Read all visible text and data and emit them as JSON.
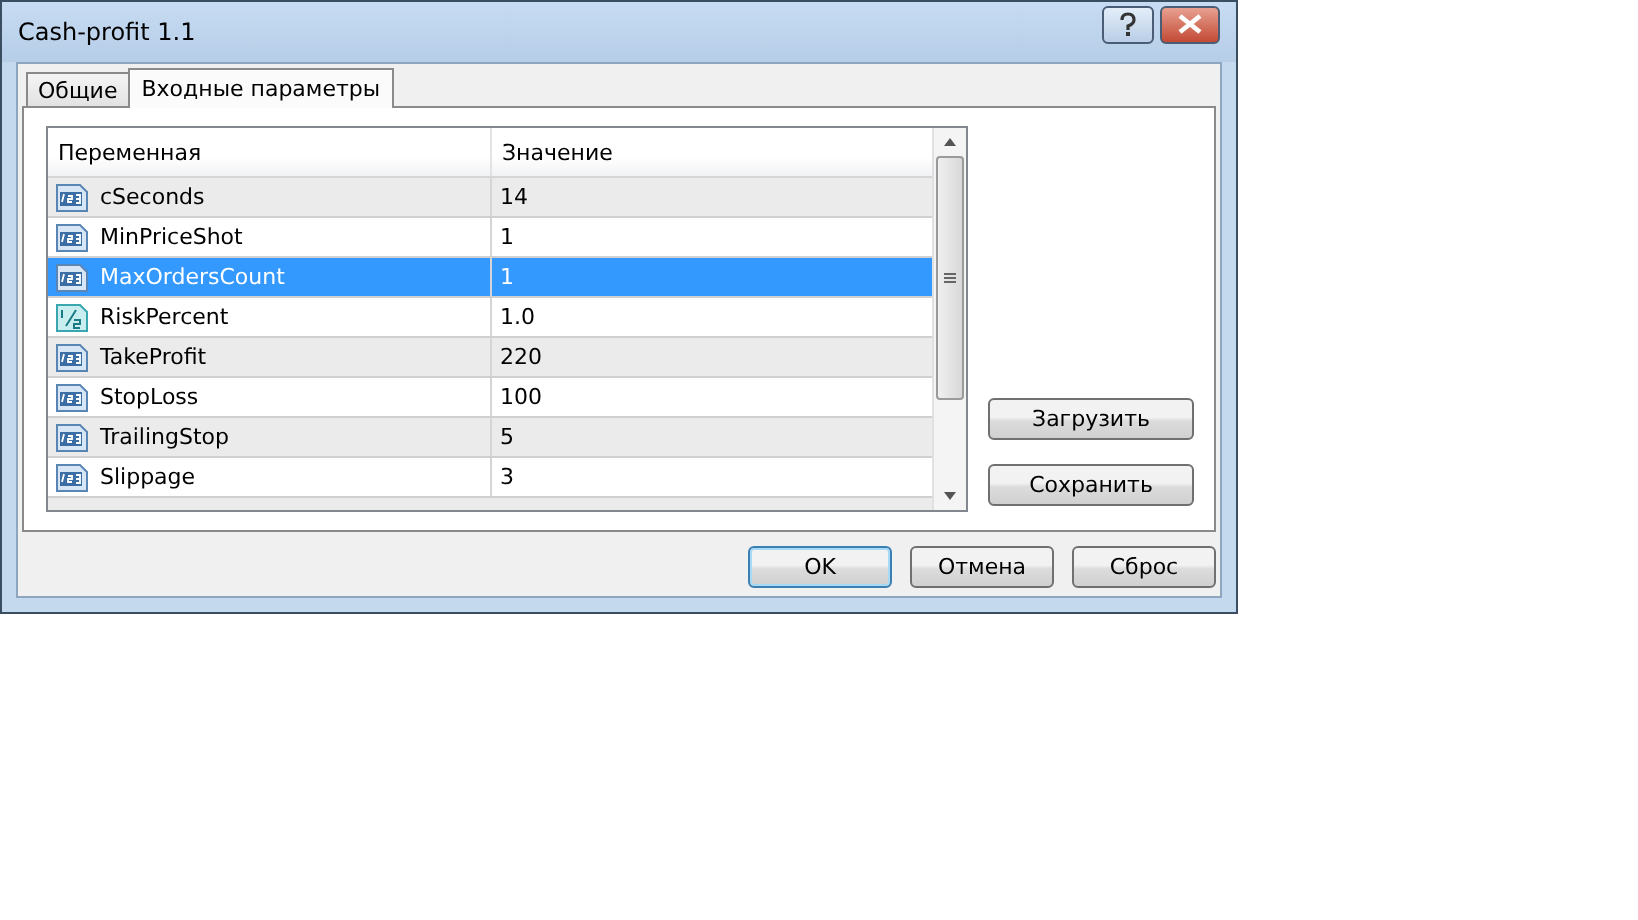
{
  "window": {
    "title": "Cash-profit 1.1"
  },
  "tabs": [
    {
      "label": "Общие",
      "selected": false
    },
    {
      "label": "Входные параметры",
      "selected": true
    }
  ],
  "table": {
    "columns": [
      "Переменная",
      "Значение"
    ],
    "rows": [
      {
        "kind": "int",
        "name": "cSeconds",
        "value": "14",
        "selected": false
      },
      {
        "kind": "int",
        "name": "MinPriceShot",
        "value": "1",
        "selected": false
      },
      {
        "kind": "int",
        "name": "MaxOrdersCount",
        "value": "1",
        "selected": true
      },
      {
        "kind": "double",
        "name": "RiskPercent",
        "value": "1.0",
        "selected": false
      },
      {
        "kind": "int",
        "name": "TakeProfit",
        "value": "220",
        "selected": false
      },
      {
        "kind": "int",
        "name": "StopLoss",
        "value": "100",
        "selected": false
      },
      {
        "kind": "int",
        "name": "TrailingStop",
        "value": "5",
        "selected": false
      },
      {
        "kind": "int",
        "name": "Slippage",
        "value": "3",
        "selected": false
      }
    ]
  },
  "side_buttons": [
    "Загрузить",
    "Сохранить"
  ],
  "buttons": [
    {
      "label": "OK",
      "default": true
    },
    {
      "label": "Отмена",
      "default": false
    },
    {
      "label": "Сброс",
      "default": false
    }
  ]
}
